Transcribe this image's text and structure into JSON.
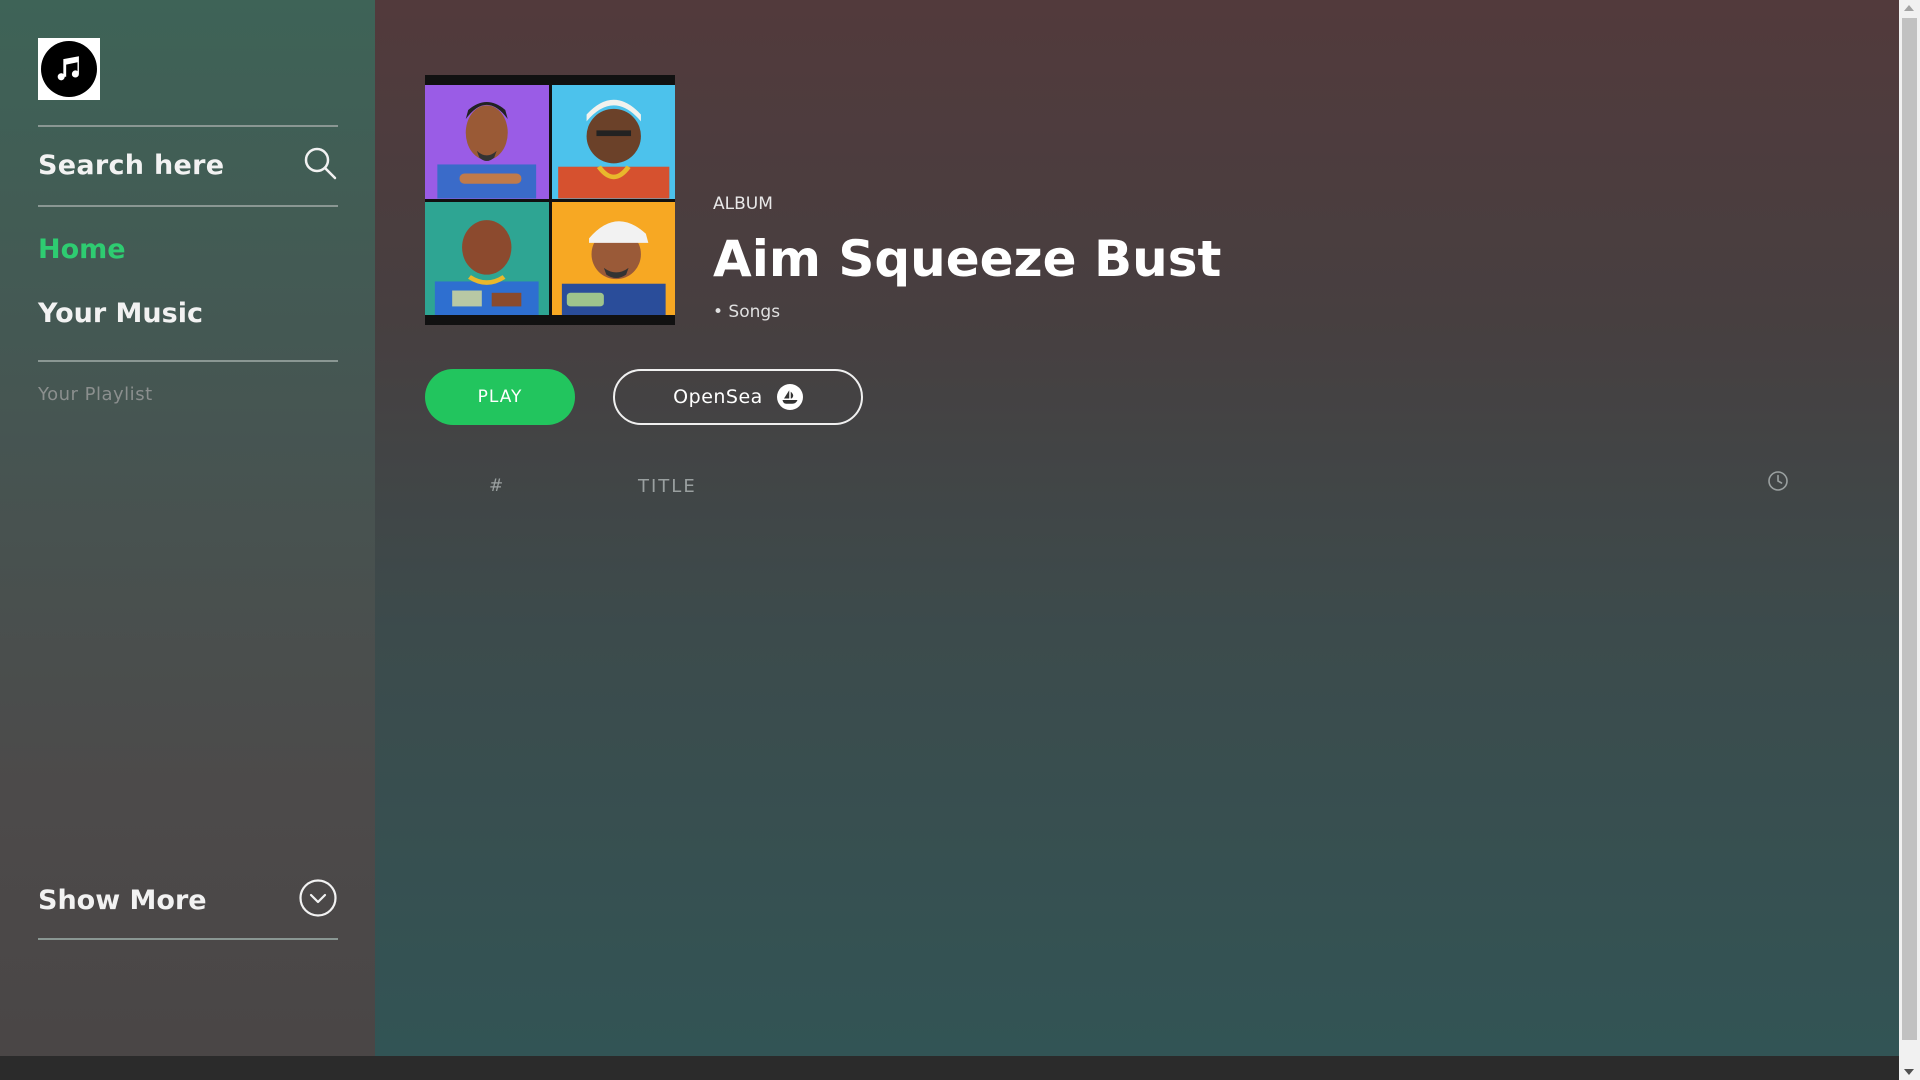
{
  "sidebar": {
    "logo_icon": "music-note-icon",
    "search_placeholder": "Search here",
    "search_icon": "search-icon",
    "nav": [
      {
        "label": "Home",
        "active": true
      },
      {
        "label": "Your Music",
        "active": false
      }
    ],
    "playlist_label": "Your Playlist",
    "show_more_label": "Show More",
    "show_more_icon": "chevron-down-circle-icon"
  },
  "album": {
    "type_label": "ALBUM",
    "title": "Aim Squeeze Bust",
    "meta": "• Songs",
    "play_label": "PLAY",
    "opensea_label": "OpenSea",
    "opensea_icon": "opensea-boat-icon"
  },
  "tracklist": {
    "col_number": "#",
    "col_title": "TITLE",
    "col_duration_icon": "clock-icon"
  },
  "colors": {
    "accent": "#22c55e",
    "active_nav": "#2ecc71"
  }
}
